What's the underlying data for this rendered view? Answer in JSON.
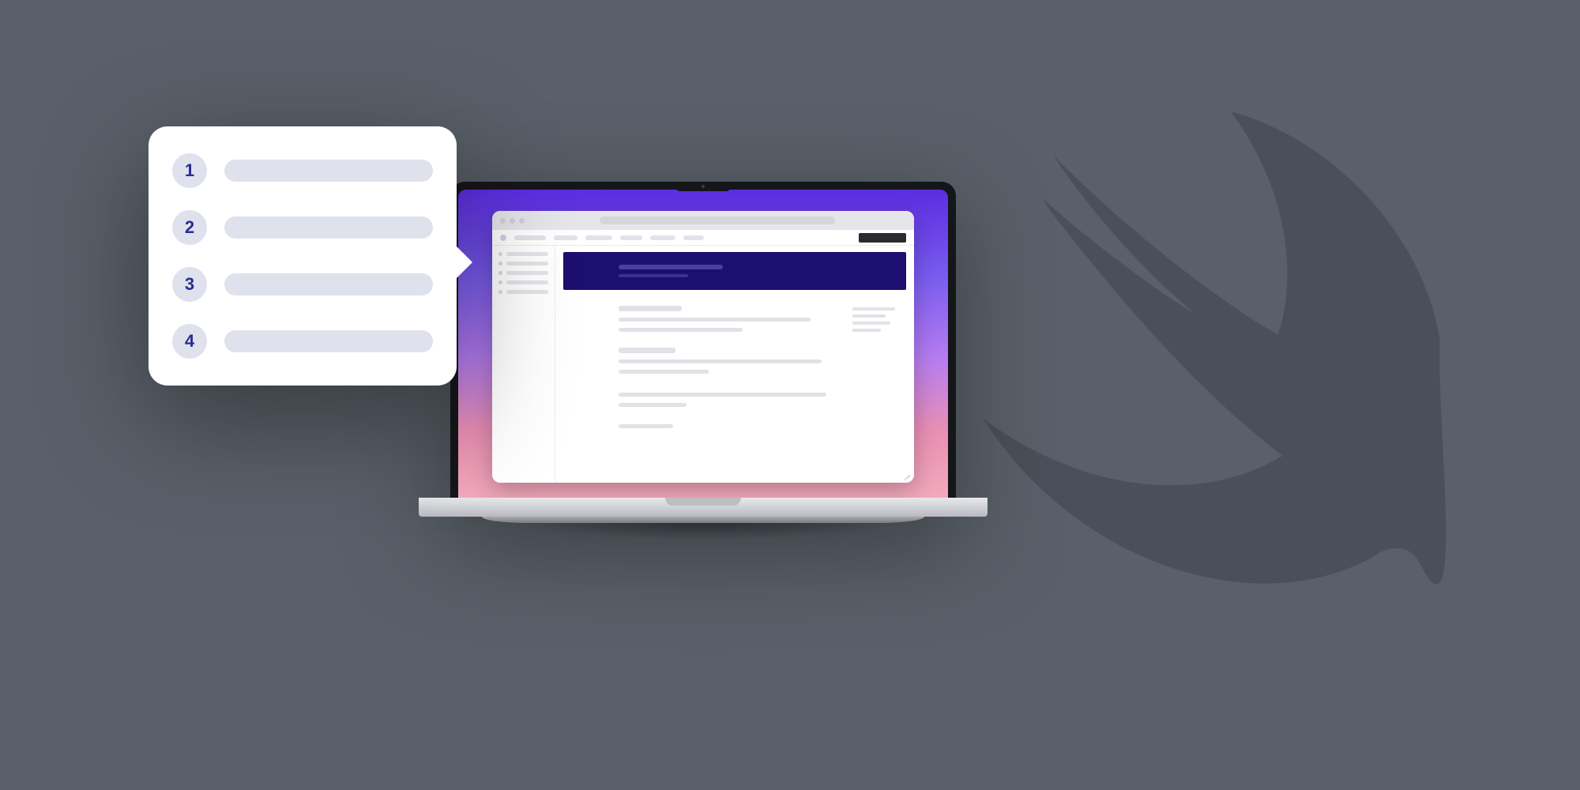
{
  "steps": [
    {
      "number": "1"
    },
    {
      "number": "2"
    },
    {
      "number": "3"
    },
    {
      "number": "4"
    }
  ],
  "decorative": {
    "background_bird": "swift-bird-silhouette",
    "device": "macbook-laptop"
  }
}
